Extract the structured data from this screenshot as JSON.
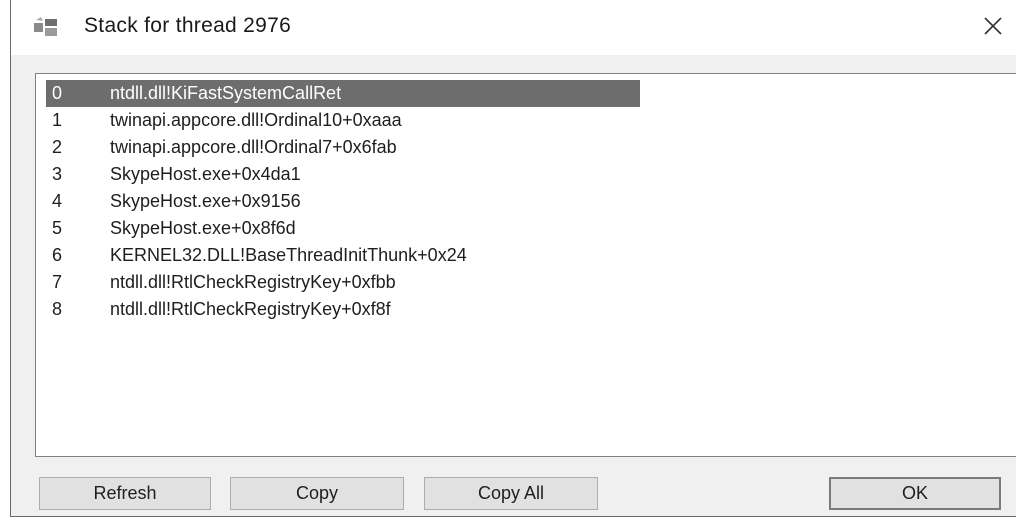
{
  "window": {
    "title": "Stack for thread 2976",
    "icon": "app-icon",
    "close_icon": "close-icon"
  },
  "stack": {
    "selected_index": 0,
    "frames": [
      {
        "index": "0",
        "function": "ntdll.dll!KiFastSystemCallRet"
      },
      {
        "index": "1",
        "function": "twinapi.appcore.dll!Ordinal10+0xaaa"
      },
      {
        "index": "2",
        "function": "twinapi.appcore.dll!Ordinal7+0x6fab"
      },
      {
        "index": "3",
        "function": "SkypeHost.exe+0x4da1"
      },
      {
        "index": "4",
        "function": "SkypeHost.exe+0x9156"
      },
      {
        "index": "5",
        "function": "SkypeHost.exe+0x8f6d"
      },
      {
        "index": "6",
        "function": "KERNEL32.DLL!BaseThreadInitThunk+0x24"
      },
      {
        "index": "7",
        "function": "ntdll.dll!RtlCheckRegistryKey+0xfbb"
      },
      {
        "index": "8",
        "function": "ntdll.dll!RtlCheckRegistryKey+0xf8f"
      }
    ]
  },
  "buttons": {
    "refresh": "Refresh",
    "copy": "Copy",
    "copy_all": "Copy All",
    "ok": "OK"
  },
  "colors": {
    "selection": "#6d6d6d",
    "dialog_bg": "#f0f0f0",
    "button_bg": "#e1e1e1"
  }
}
